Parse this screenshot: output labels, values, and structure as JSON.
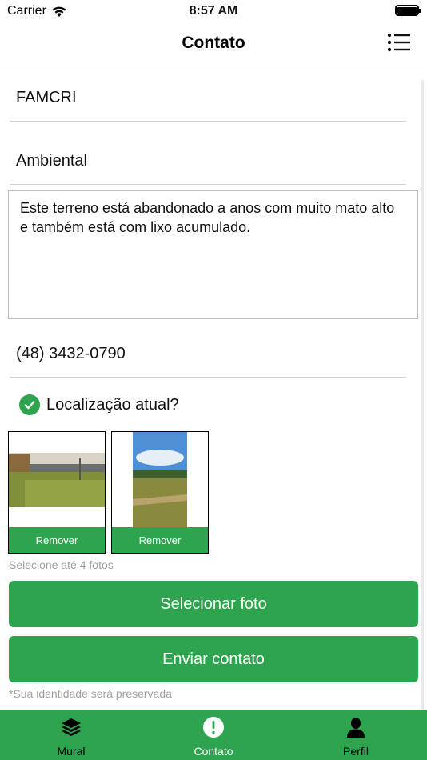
{
  "status_bar": {
    "carrier": "Carrier",
    "time": "8:57 AM"
  },
  "nav": {
    "title": "Contato",
    "menu_icon": "list-icon"
  },
  "form": {
    "organization": "FAMCRI",
    "category": "Ambiental",
    "message": "Este terreno está abandonado a anos com muito mato alto e também está com lixo acumulado.",
    "phone": "(48) 3432-0790",
    "location_checked": true,
    "location_label": "Localização atual?"
  },
  "photos": {
    "items": [
      {
        "remove_label": "Remover",
        "orientation": "landscape"
      },
      {
        "remove_label": "Remover",
        "orientation": "portrait"
      }
    ],
    "hint": "Selecione até 4 fotos"
  },
  "actions": {
    "select_photo_label": "Selecionar foto",
    "send_contact_label": "Enviar contato"
  },
  "privacy_note": "*Sua identidade será preservada",
  "tab_bar": {
    "items": [
      {
        "label": "Mural",
        "icon": "layers-icon",
        "active": false
      },
      {
        "label": "Contato",
        "icon": "alert-icon",
        "active": true
      },
      {
        "label": "Perfil",
        "icon": "person-icon",
        "active": false
      }
    ]
  },
  "colors": {
    "accent": "#2ea44f",
    "hint_text": "#a0a0a0"
  }
}
